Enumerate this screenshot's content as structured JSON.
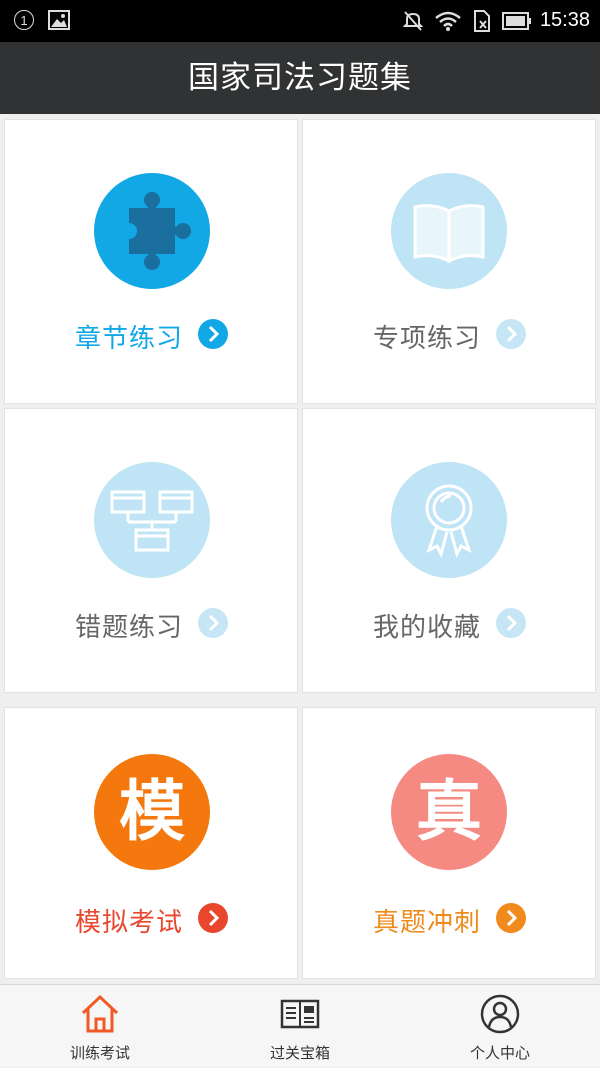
{
  "status_bar": {
    "notification_count": "1",
    "time": "15:38"
  },
  "header": {
    "title": "国家司法习题集"
  },
  "tiles": [
    {
      "label": "章节练习",
      "icon": "puzzle-icon",
      "color": "#12a8e6",
      "label_color": "#12a8e6"
    },
    {
      "label": "专项练习",
      "icon": "book-icon",
      "color": "#bfe4f5",
      "label_color": "#666666"
    },
    {
      "label": "错题练习",
      "icon": "diagram-icon",
      "color": "#bfe4f5",
      "label_color": "#666666"
    },
    {
      "label": "我的收藏",
      "icon": "ribbon-award-icon",
      "color": "#bfe4f5",
      "label_color": "#666666"
    },
    {
      "label": "模拟考试",
      "icon": "mo-character-icon",
      "icon_text": "模",
      "color": "#f5780f",
      "label_color": "#e8472e"
    },
    {
      "label": "真题冲刺",
      "icon": "zhen-character-icon",
      "icon_text": "真",
      "color": "#f58a82",
      "label_color": "#f08a1c"
    }
  ],
  "bottom_nav": [
    {
      "label": "训练考试",
      "icon": "home-icon",
      "active": true
    },
    {
      "label": "过关宝箱",
      "icon": "news-book-icon",
      "active": false
    },
    {
      "label": "个人中心",
      "icon": "person-icon",
      "active": false
    }
  ]
}
